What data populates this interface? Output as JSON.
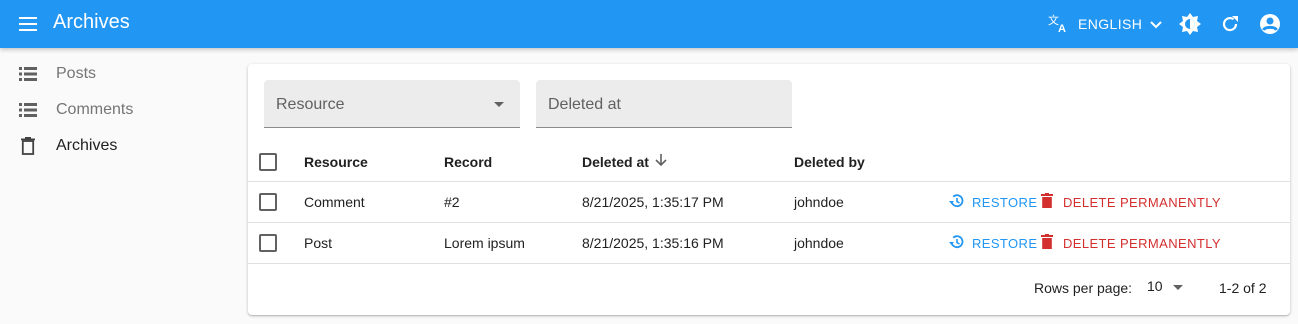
{
  "header": {
    "title": "Archives",
    "language": "ENGLISH",
    "menu_icon": "menu-icon",
    "translate_icon": "translate-icon",
    "theme_icon": "brightness-icon",
    "refresh_icon": "refresh-icon",
    "account_icon": "account-circle-icon"
  },
  "sidebar": {
    "items": [
      {
        "label": "Posts",
        "icon": "list-icon"
      },
      {
        "label": "Comments",
        "icon": "list-icon"
      },
      {
        "label": "Archives",
        "icon": "trash-icon"
      }
    ]
  },
  "filters": {
    "resource": "Resource",
    "deleted_at": "Deleted at"
  },
  "table": {
    "columns": [
      "Resource",
      "Record",
      "Deleted at",
      "Deleted by"
    ],
    "sort_indicator": "arrow-down-icon",
    "rows": [
      {
        "resource": "Comment",
        "record": "#2",
        "deleted_at": "8/21/2025, 1:35:17 PM",
        "deleted_by": "johndoe"
      },
      {
        "resource": "Post",
        "record": "Lorem ipsum",
        "deleted_at": "8/21/2025, 1:35:16 PM",
        "deleted_by": "johndoe"
      }
    ],
    "restore_label": "RESTORE",
    "delete_label": "DELETE PERMANENTLY"
  },
  "pagination": {
    "rows_per_page_label": "Rows per page:",
    "rows_per_page": "10",
    "range": "1-2 of 2"
  },
  "colors": {
    "primary": "#2196f3",
    "danger": "#d32f2f"
  }
}
